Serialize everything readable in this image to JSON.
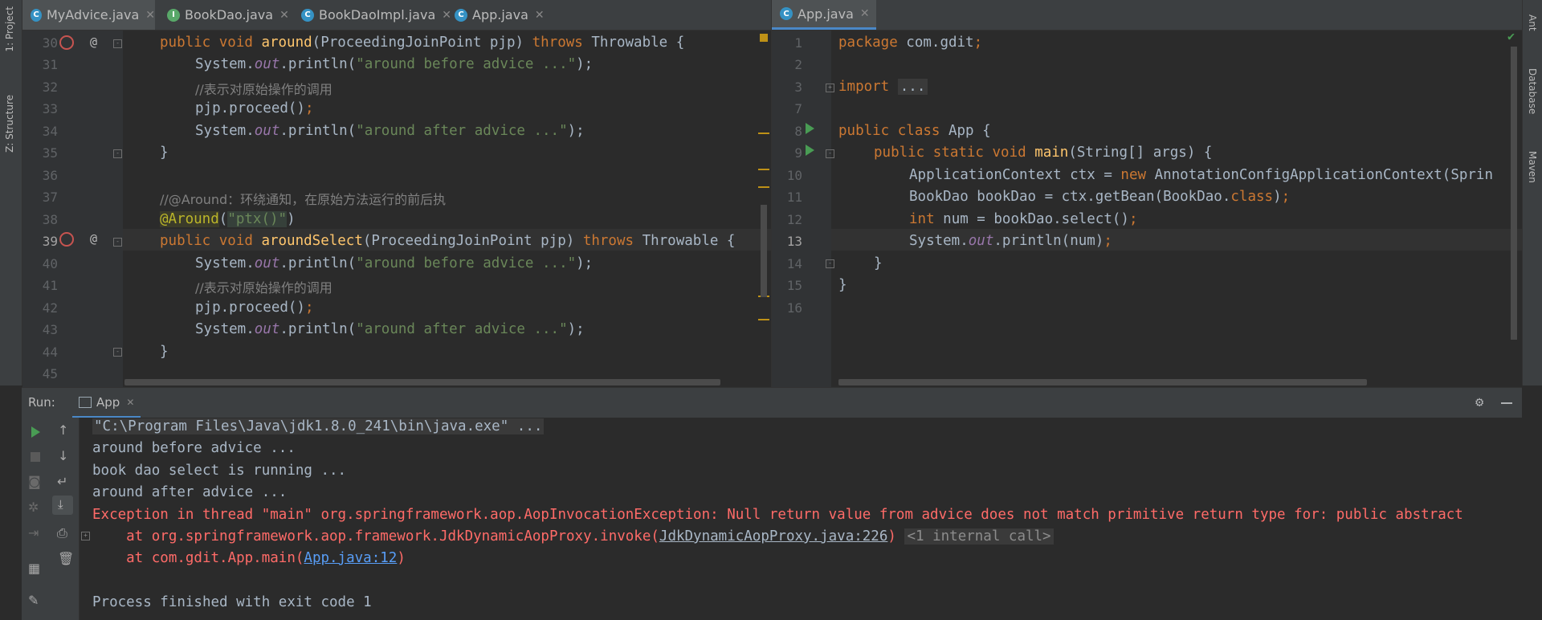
{
  "side_left": {
    "project": "1: Project",
    "structure": "Z: Structure"
  },
  "side_right": {
    "ant": "Ant",
    "database": "Database",
    "maven": "Maven"
  },
  "left_tabs": [
    {
      "label": "MyAdvice.java",
      "icon": "C"
    },
    {
      "label": "BookDao.java",
      "icon": "I"
    },
    {
      "label": "BookDaoImpl.java",
      "icon": "C"
    },
    {
      "label": "App.java",
      "icon": "C"
    }
  ],
  "right_tabs": [
    {
      "label": "App.java",
      "icon": "C"
    }
  ],
  "left_lines": [
    "30",
    "31",
    "32",
    "33",
    "34",
    "35",
    "36",
    "37",
    "38",
    "39",
    "40",
    "41",
    "42",
    "43",
    "44",
    "45"
  ],
  "right_lines": [
    "1",
    "2",
    "3",
    "7",
    "8",
    "9",
    "10",
    "11",
    "12",
    "13",
    "14",
    "15",
    "16"
  ],
  "left_code": {
    "l30a": "public void ",
    "l30b": "around",
    "l30c": "(ProceedingJoinPoint pjp) ",
    "l30d": "throws ",
    "l30e": "Throwable {",
    "l31a": "System.",
    "l31b": "out",
    "l31c": ".println(",
    "l31d": "\"around before advice ...\"",
    "l31e": ");",
    "l32": "//表示对原始操作的调用",
    "l33a": "pjp.proceed()",
    "l33b": ";",
    "l34a": "System.",
    "l34b": "out",
    "l34c": ".println(",
    "l34d": "\"around after advice ...\"",
    "l34e": ");",
    "l35": "}",
    "l37": "//@Around：环绕通知，在原始方法运行的前后执",
    "l38a": "@Around",
    "l38b": "(",
    "l38c": "\"ptx()\"",
    "l38d": ")",
    "l39a": "public void ",
    "l39b": "aroundSelect",
    "l39c": "(ProceedingJoinPoint pjp) ",
    "l39d": "throws ",
    "l39e": "Throwable {",
    "l40a": "System.",
    "l40b": "out",
    "l40c": ".println(",
    "l40d": "\"around before advice ...\"",
    "l40e": ");",
    "l41": "//表示对原始操作的调用",
    "l42a": "pjp.proceed()",
    "l42b": ";",
    "l43a": "System.",
    "l43b": "out",
    "l43c": ".println(",
    "l43d": "\"around after advice ...\"",
    "l43e": ");",
    "l44": "}"
  },
  "right_code": {
    "r1a": "package ",
    "r1b": "com.gdit",
    "r1c": ";",
    "r3a": "import ",
    "r3b": "...",
    "r8a": "public class ",
    "r8b": "App {",
    "r9a": "public static void ",
    "r9b": "main",
    "r9c": "(String[] args) {",
    "r10a": "ApplicationContext ctx = ",
    "r10b": "new ",
    "r10c": "AnnotationConfigApplicationContext(Sprin",
    "r11a": "BookDao bookDao = ctx.getBean(BookDao.",
    "r11b": "class",
    "r11c": ")",
    "r11d": ";",
    "r12a": "int ",
    "r12b": "num = bookDao.select()",
    "r12c": ";",
    "r13a": "System.",
    "r13b": "out",
    "r13c": ".println(num)",
    "r13d": ";",
    "r14": "}",
    "r15": "}"
  },
  "run": {
    "label": "Run:",
    "tab": "App",
    "output": {
      "o1": "\"C:\\Program Files\\Java\\jdk1.8.0_241\\bin\\java.exe\" ...",
      "o2": "around before advice ...",
      "o3": "book dao select is running ...",
      "o4": "around after advice ...",
      "o5": "Exception in thread \"main\" org.springframework.aop.AopInvocationException: Null return value from advice does not match primitive return type for: public abstract",
      "o6a": "    at org.springframework.aop.framework.JdkDynamicAopProxy.invoke(",
      "o6b": "JdkDynamicAopProxy.java:226",
      "o6c": ")",
      "o6d": "<1 internal call>",
      "o7a": "    at com.gdit.App.main(",
      "o7b": "App.java:12",
      "o7c": ")",
      "o8": "Process finished with exit code 1"
    }
  }
}
